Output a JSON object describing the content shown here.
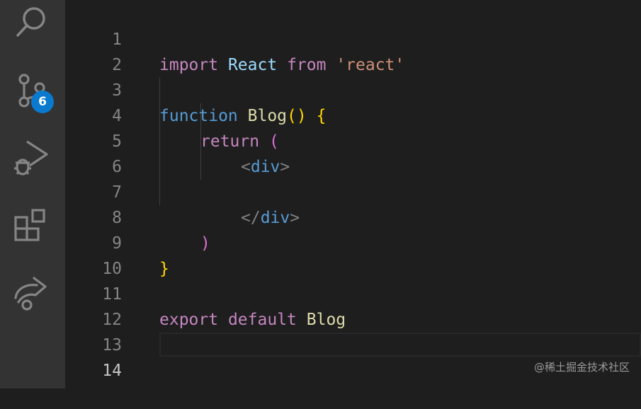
{
  "activity_bar": {
    "icons": [
      "search-icon",
      "source-control-icon",
      "run-debug-icon",
      "extensions-icon",
      "live-share-icon"
    ],
    "scm_badge": "6",
    "badge_color": "#0a7acf"
  },
  "editor": {
    "lines": [
      {
        "n": "1"
      },
      {
        "n": "2"
      },
      {
        "n": "3"
      },
      {
        "n": "4"
      },
      {
        "n": "5"
      },
      {
        "n": "6"
      },
      {
        "n": "7"
      },
      {
        "n": "8"
      },
      {
        "n": "9"
      },
      {
        "n": "10"
      },
      {
        "n": "11"
      },
      {
        "n": "12"
      },
      {
        "n": "13"
      },
      {
        "n": "14"
      }
    ],
    "tokens": {
      "l1": [
        "import",
        " ",
        "React",
        " ",
        "from",
        " ",
        "'react'"
      ],
      "l3": [
        "function",
        " ",
        "Blog",
        "()",
        " ",
        "{"
      ],
      "l4": [
        "return",
        " ",
        "("
      ],
      "l5": [
        "<",
        "div",
        ">"
      ],
      "l7": [
        "</",
        "div",
        ">"
      ],
      "l8": [
        ")"
      ],
      "l9": [
        "}"
      ],
      "l11": [
        "export",
        " ",
        "default",
        " ",
        "Blog"
      ]
    }
  },
  "watermark": "@稀土掘金技术社区"
}
